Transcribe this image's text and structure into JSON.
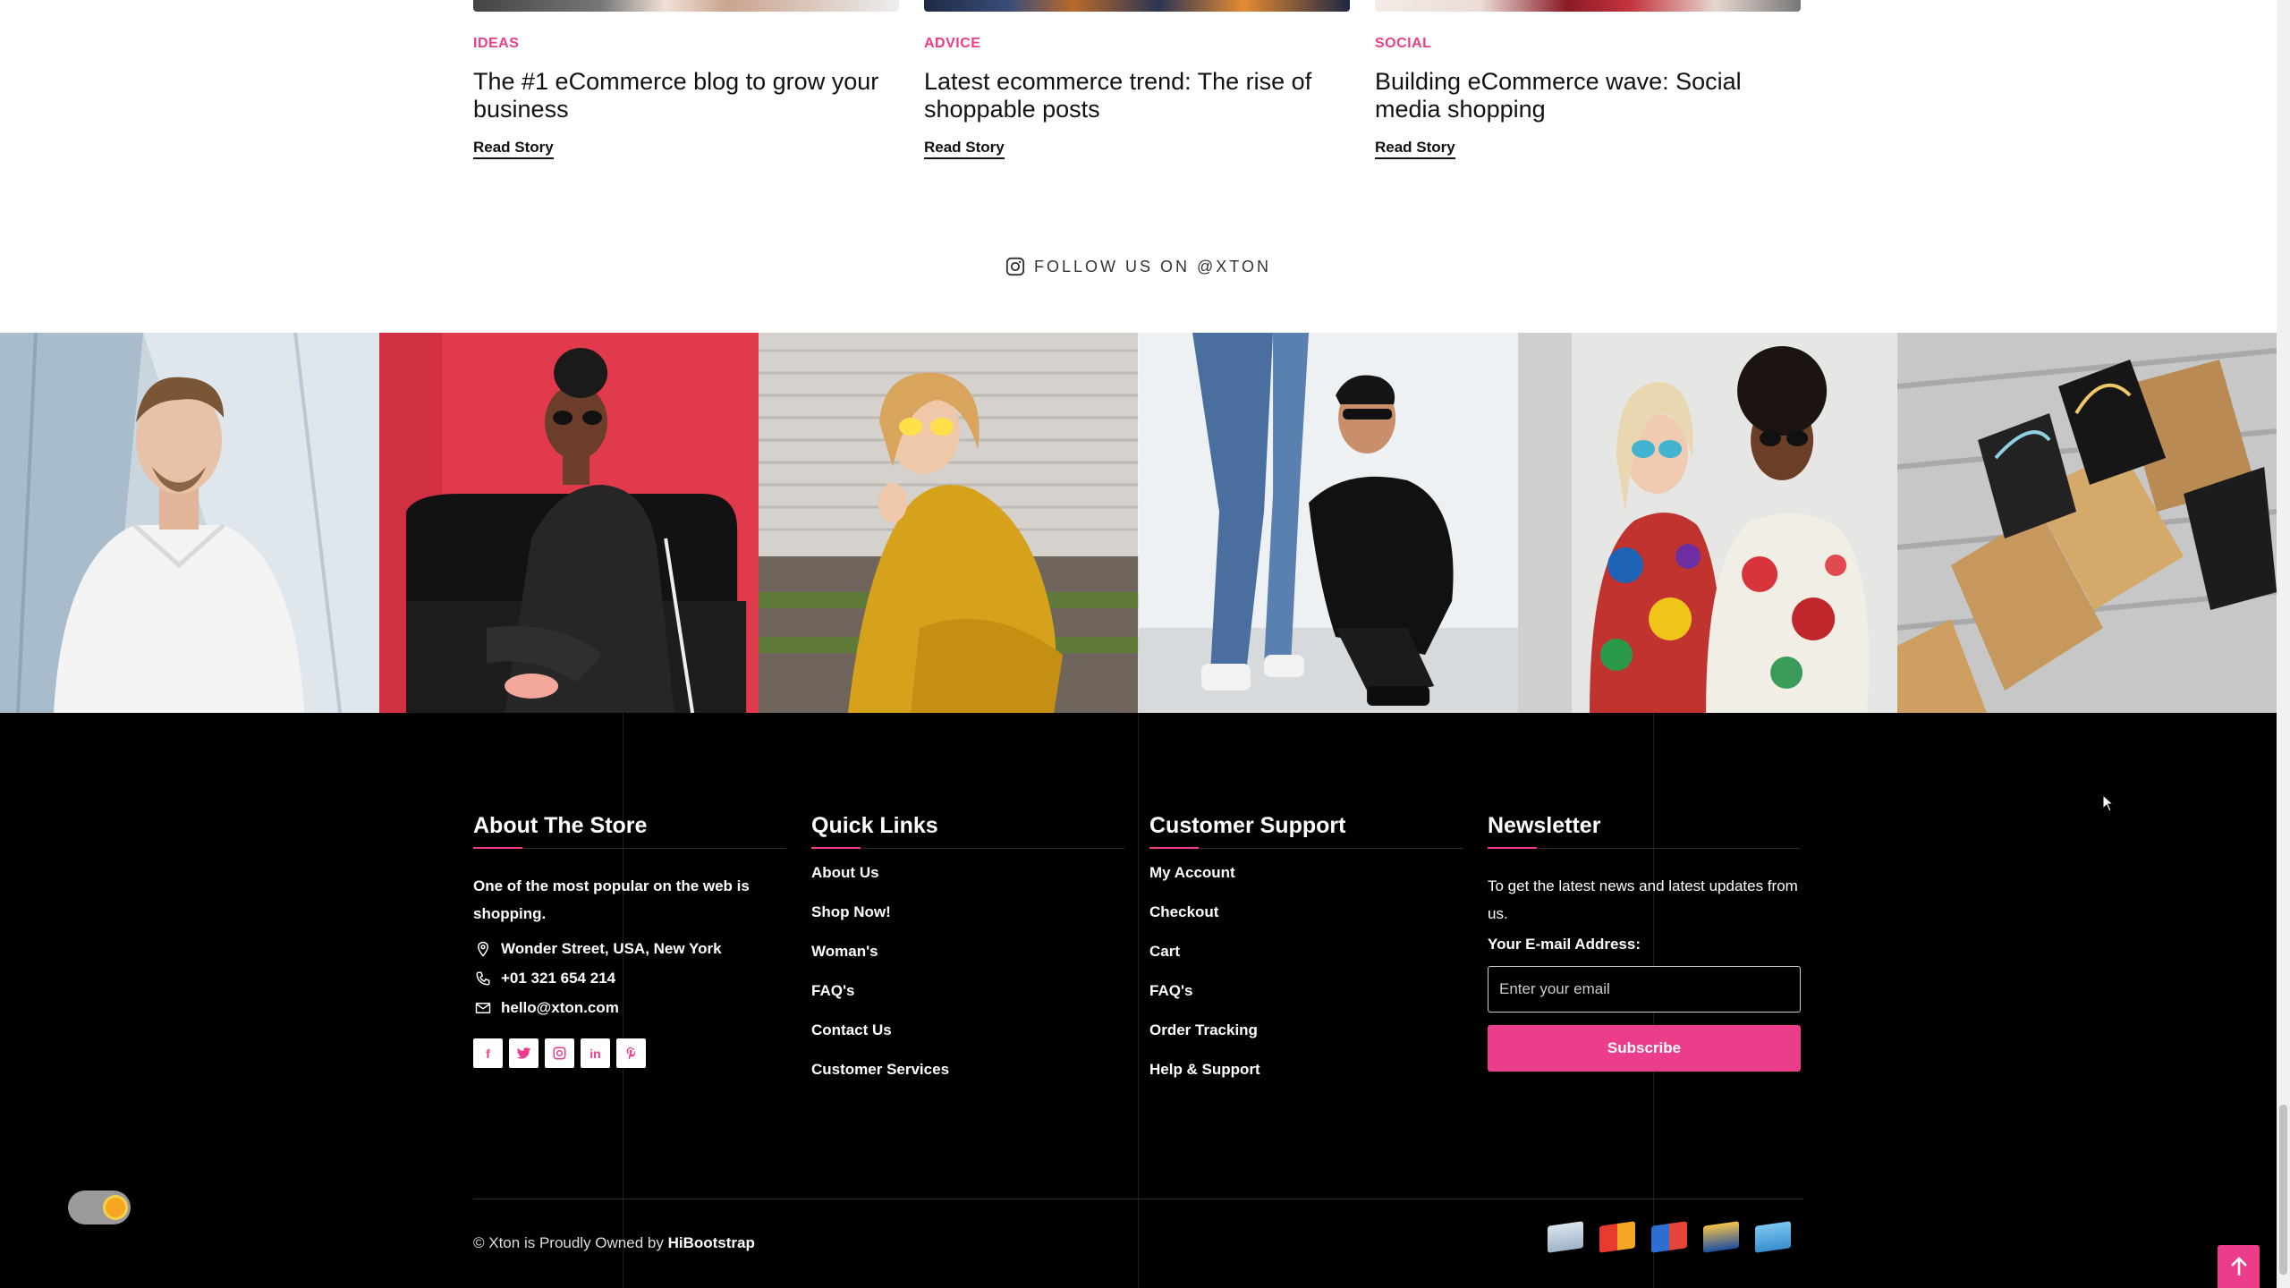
{
  "blog": {
    "posts": [
      {
        "category": "IDEAS",
        "title": "The #1 eCommerce blog to grow your business",
        "link": "Read Story"
      },
      {
        "category": "ADVICE",
        "title": "Latest ecommerce trend: The rise of shoppable posts",
        "link": "Read Story"
      },
      {
        "category": "SOCIAL",
        "title": "Building eCommerce wave: Social media shopping",
        "link": "Read Story"
      }
    ],
    "follow_label": "FOLLOW US ON @XTON"
  },
  "instagram": {
    "tiles": [
      {
        "name": "man-white-polo"
      },
      {
        "name": "woman-pink-wall-sofa"
      },
      {
        "name": "woman-yellow-dress"
      },
      {
        "name": "couple-sitting-denim"
      },
      {
        "name": "women-sunglasses-patterned"
      },
      {
        "name": "shopping-bags"
      }
    ]
  },
  "footer": {
    "about": {
      "title": "About The Store",
      "description": "One of the most popular on the web is shopping.",
      "address": "Wonder Street, USA, New York",
      "phone": "+01 321 654 214",
      "email": "hello@xton.com",
      "socials": [
        "f",
        "t",
        "ig",
        "in",
        "p"
      ]
    },
    "quick_links": {
      "title": "Quick Links",
      "items": [
        "About Us",
        "Shop Now!",
        "Woman's",
        "FAQ's",
        "Contact Us",
        "Customer Services"
      ]
    },
    "support": {
      "title": "Customer Support",
      "items": [
        "My Account",
        "Checkout",
        "Cart",
        "FAQ's",
        "Order Tracking",
        "Help & Support"
      ]
    },
    "newsletter": {
      "title": "Newsletter",
      "text": "To get the latest news and latest updates from us.",
      "label": "Your E-mail Address:",
      "placeholder": "Enter your email",
      "button": "Subscribe"
    },
    "copyright_prefix": "© Xton is Proudly Owned by",
    "copyright_brand": "HiBootstrap",
    "payment_cards": [
      "visa",
      "mastercard",
      "maestro",
      "visa-gold",
      "amex"
    ]
  },
  "colors": {
    "accent": "#ec3d8b",
    "footer_bg": "#000000"
  }
}
